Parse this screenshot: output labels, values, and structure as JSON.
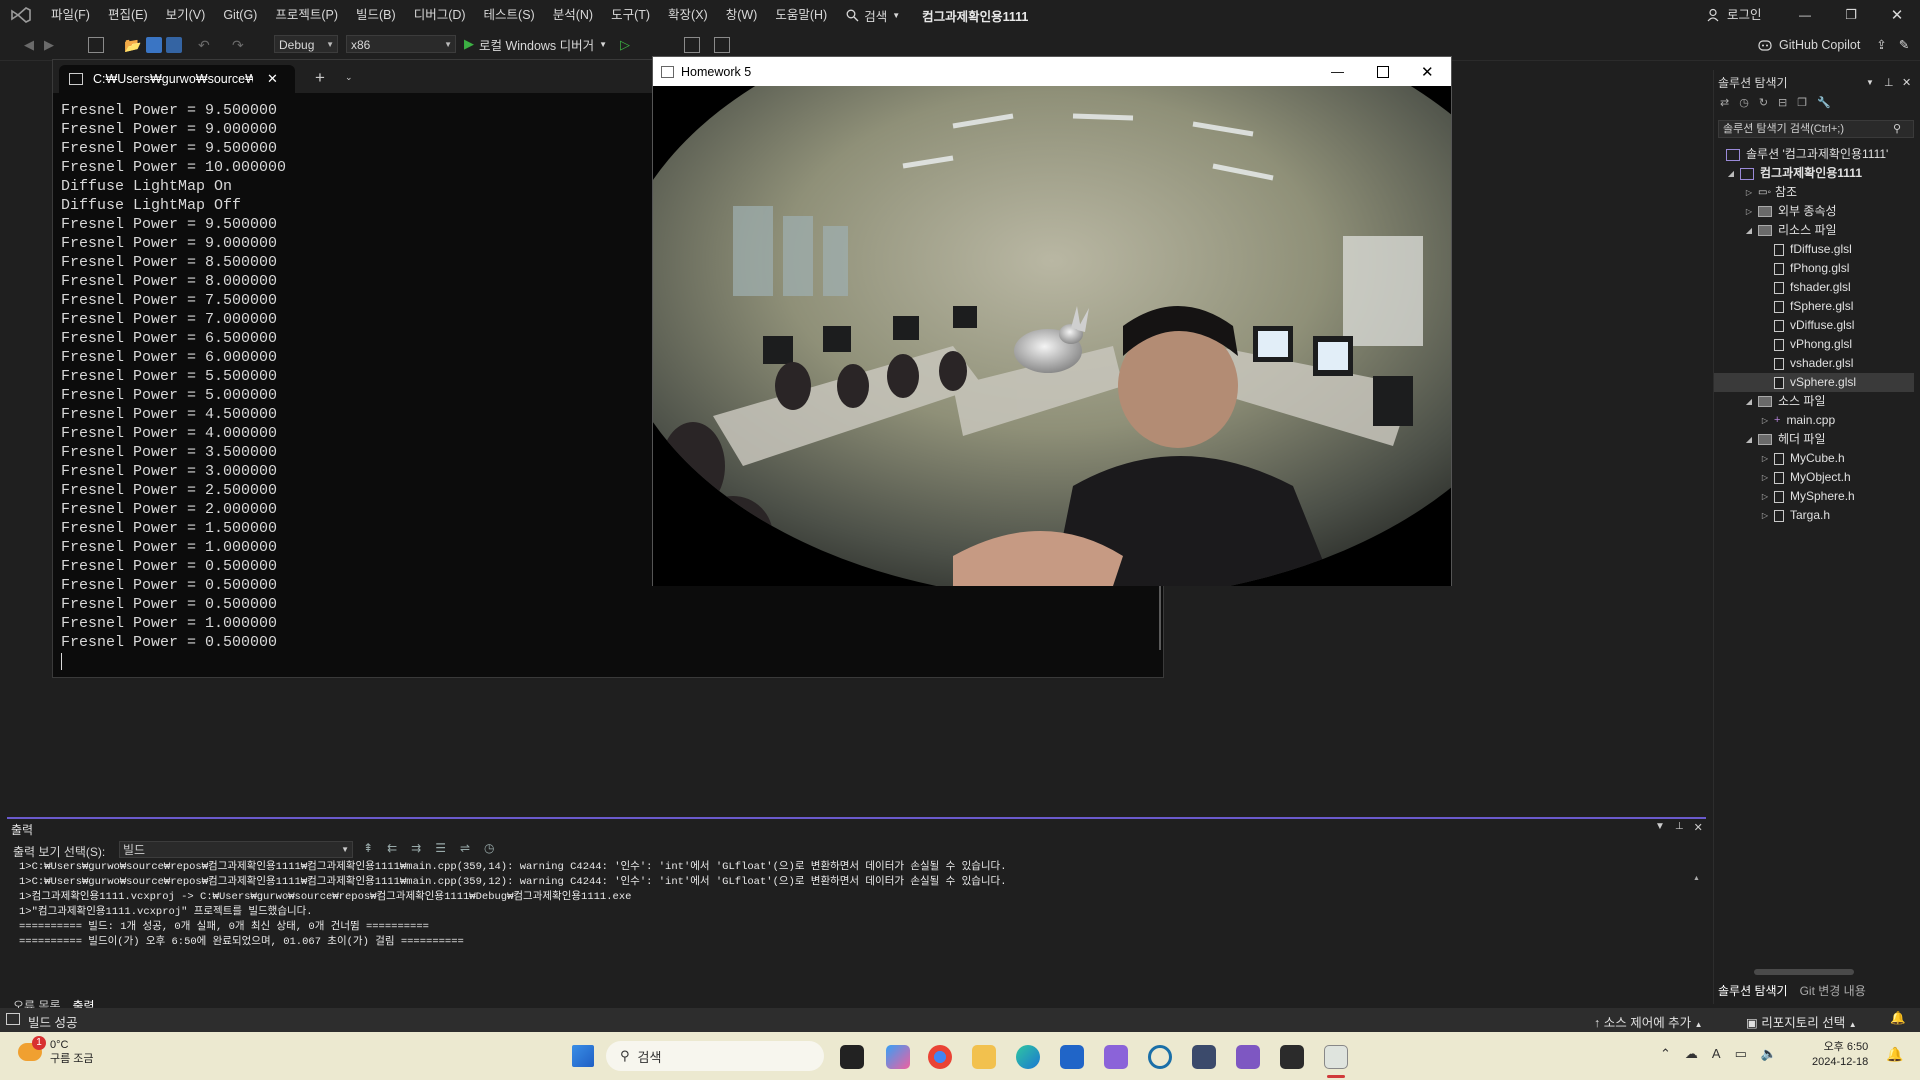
{
  "menubar": {
    "items": [
      "파일(F)",
      "편집(E)",
      "보기(V)",
      "Git(G)",
      "프로젝트(P)",
      "빌드(B)",
      "디버그(D)",
      "테스트(S)",
      "분석(N)",
      "도구(T)",
      "확장(X)",
      "창(W)",
      "도움말(H)"
    ],
    "search_label": "검색",
    "solution_title": "컴그과제확인용1111",
    "login_label": "로그인"
  },
  "toolbar": {
    "config": "Debug",
    "platform": "x86",
    "run_label": "로컬 Windows 디버거",
    "copilot_label": "GitHub Copilot"
  },
  "console": {
    "tab_title": "C:₩Users₩gurwo₩source₩rep",
    "lines": [
      "Fresnel Power = 9.500000",
      "Fresnel Power = 9.000000",
      "Fresnel Power = 9.500000",
      "Fresnel Power = 10.000000",
      "Diffuse LightMap On",
      "Diffuse LightMap Off",
      "Fresnel Power = 9.500000",
      "Fresnel Power = 9.000000",
      "Fresnel Power = 8.500000",
      "Fresnel Power = 8.000000",
      "Fresnel Power = 7.500000",
      "Fresnel Power = 7.000000",
      "Fresnel Power = 6.500000",
      "Fresnel Power = 6.000000",
      "Fresnel Power = 5.500000",
      "Fresnel Power = 5.000000",
      "Fresnel Power = 4.500000",
      "Fresnel Power = 4.000000",
      "Fresnel Power = 3.500000",
      "Fresnel Power = 3.000000",
      "Fresnel Power = 2.500000",
      "Fresnel Power = 2.000000",
      "Fresnel Power = 1.500000",
      "Fresnel Power = 1.000000",
      "Fresnel Power = 0.500000",
      "Fresnel Power = 0.500000",
      "Fresnel Power = 0.500000",
      "Fresnel Power = 1.000000",
      "Fresnel Power = 0.500000"
    ]
  },
  "homework": {
    "title": "Homework 5"
  },
  "solution_explorer": {
    "title": "솔루션 탐색기",
    "search_placeholder": "솔루션 탐색기 검색(Ctrl+;)",
    "solution_label": "솔루션 '컴그과제확인용1111'",
    "project_label": "컴그과제확인용1111",
    "nodes": {
      "references": "참조",
      "external": "외부 종속성",
      "resources": "리소스 파일",
      "sources": "소스 파일",
      "headers": "헤더 파일"
    },
    "resource_files": [
      "fDiffuse.glsl",
      "fPhong.glsl",
      "fshader.glsl",
      "fSphere.glsl",
      "vDiffuse.glsl",
      "vPhong.glsl",
      "vshader.glsl",
      "vSphere.glsl"
    ],
    "source_files": [
      "main.cpp"
    ],
    "header_files": [
      "MyCube.h",
      "MyObject.h",
      "MySphere.h",
      "Targa.h"
    ],
    "bottom_tabs": [
      "솔루션 탐색기",
      "Git 변경 내용"
    ]
  },
  "output": {
    "title": "출력",
    "source_label": "출력 보기 선택(S):",
    "source_value": "빌드",
    "lines": [
      "1>C:₩Users₩gurwo₩source₩repos₩컴그과제확인용1111₩컴그과제확인용1111₩main.cpp(359,14): warning C4244: '인수': 'int'에서 'GLfloat'(으)로 변환하면서 데이터가 손실될 수 있습니다.",
      "1>C:₩Users₩gurwo₩source₩repos₩컴그과제확인용1111₩컴그과제확인용1111₩main.cpp(359,12): warning C4244: '인수': 'int'에서 'GLfloat'(으)로 변환하면서 데이터가 손실될 수 있습니다.",
      "1>컴그과제확인용1111.vcxproj -> C:₩Users₩gurwo₩source₩repos₩컴그과제확인용1111₩Debug₩컴그과제확인용1111.exe",
      "1>\"컴그과제확인용1111.vcxproj\" 프로젝트를 빌드했습니다.",
      "========== 빌드: 1개 성공, 0개 실패, 0개 최신 상태, 0개 건너뜀 ==========",
      "========== 빌드이(가) 오후 6:50에 완료되었으며, 01.067 초이(가) 걸림 =========="
    ],
    "bottom_tabs": [
      "오류 목록",
      "출력"
    ]
  },
  "statusbar": {
    "left": "빌드 성공",
    "source_control": "소스 제어에 추가",
    "repo": "리포지토리 선택"
  },
  "taskbar": {
    "weather_temp": "0°C",
    "weather_desc": "구름 조금",
    "weather_badge": "1",
    "search_label": "검색",
    "time": "오후 6:50",
    "date": "2024-12-18",
    "ime": "A"
  },
  "colors": {
    "accent": "#6a5acd",
    "console_bg": "#0c0c0c",
    "ide_bg": "#1f1f1f",
    "taskbar_bg": "#ece9d0"
  }
}
